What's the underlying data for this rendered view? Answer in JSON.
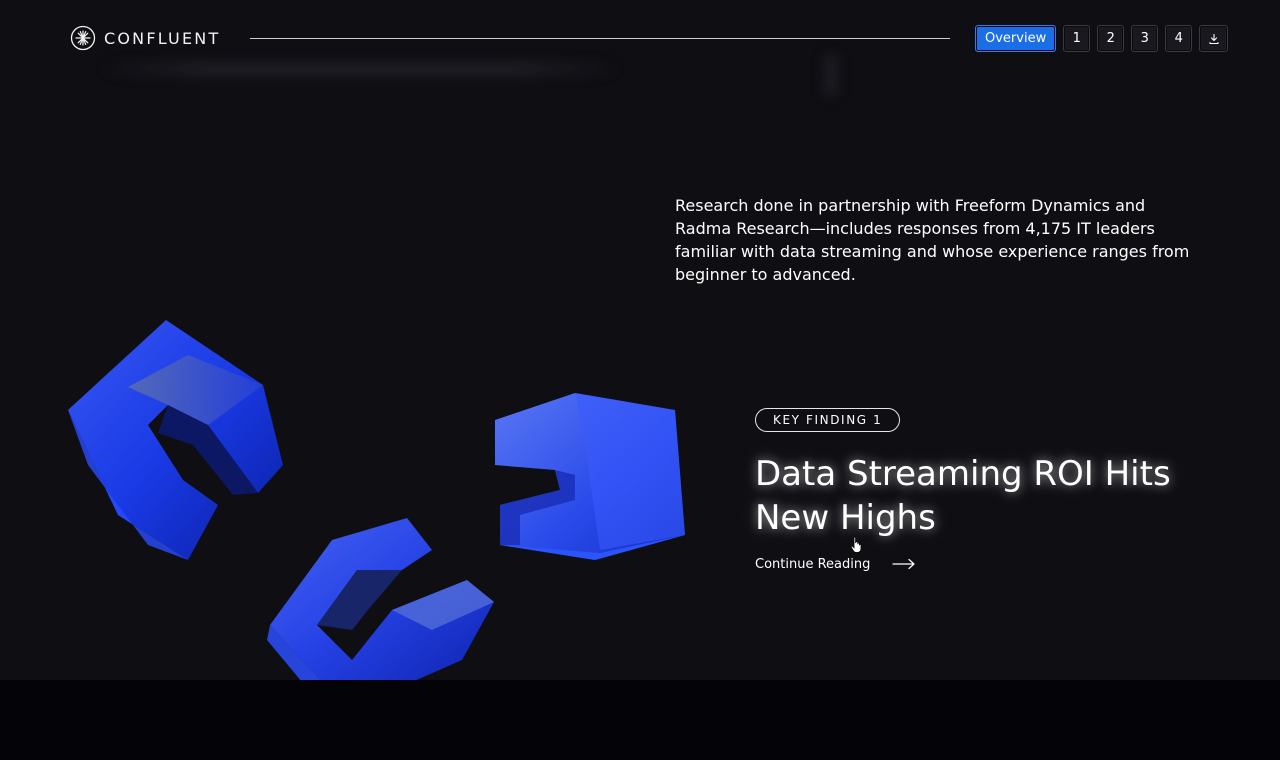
{
  "header": {
    "brand": "CONFLUENT",
    "brand_icon": "confluent-starburst-icon",
    "nav": {
      "overview_label": "Overview",
      "pages": [
        "1",
        "2",
        "3",
        "4"
      ],
      "download_icon": "download-icon"
    }
  },
  "intro": {
    "text": "Research done in partnership with Freeform Dynamics and Radma Research—includes responses from 4,175 IT leaders familiar with data streaming and whose experience ranges from beginner to advanced."
  },
  "finding": {
    "badge": "KEY FINDING 1",
    "title": "Data Streaming ROI Hits New Highs",
    "cta": "Continue Reading"
  },
  "colors": {
    "background": "#0f0e13",
    "footer": "#040307",
    "accent": "#1b6fe6",
    "shape_blue": "#1f43ff"
  }
}
